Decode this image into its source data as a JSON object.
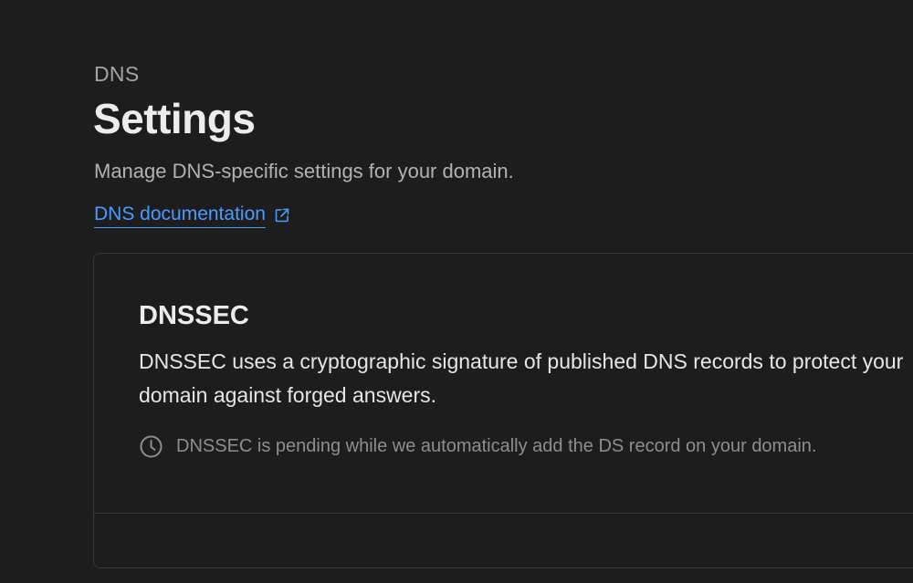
{
  "header": {
    "eyebrow": "DNS",
    "title": "Settings",
    "subtitle": "Manage DNS-specific settings for your domain.",
    "doc_link_label": "DNS documentation",
    "doc_link_icon": "external-link-icon"
  },
  "dnssec_card": {
    "title": "DNSSEC",
    "description": "DNSSEC uses a cryptographic signature of published DNS records to protect your domain against forged answers.",
    "status_icon": "clock-icon",
    "status_text": "DNSSEC is pending while we automatically add the DS record on your domain."
  },
  "colors": {
    "background": "#1d1d1d",
    "link": "#4b9bff",
    "border": "#3a3a3a"
  }
}
